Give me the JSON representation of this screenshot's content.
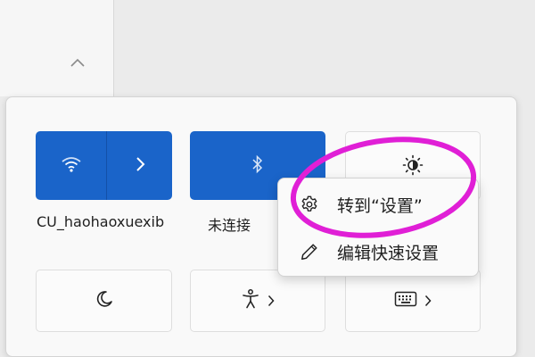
{
  "background": {
    "chevron_icon": "chevron-up-icon"
  },
  "tiles": {
    "wifi": {
      "label": "CU_haohaoxuexib",
      "icon": "wifi-icon",
      "arrow_icon": "chevron-right-icon",
      "active": true
    },
    "bluetooth": {
      "label": "未连接",
      "icon": "bluetooth-icon",
      "active": true
    },
    "brightness": {
      "icon": "brightness-icon"
    },
    "night_light": {
      "icon": "moon-icon"
    },
    "accessibility": {
      "icon": "accessibility-icon",
      "arrow_icon": "chevron-right-icon"
    },
    "keyboard": {
      "icon": "keyboard-icon",
      "arrow_icon": "chevron-right-icon"
    }
  },
  "context_menu": {
    "items": [
      {
        "label": "转到“设置”",
        "icon": "gear-icon"
      },
      {
        "label": "编辑快速设置",
        "icon": "pencil-icon"
      }
    ]
  },
  "colors": {
    "accent": "#1a64c9",
    "annotation": "#e01fd6"
  }
}
